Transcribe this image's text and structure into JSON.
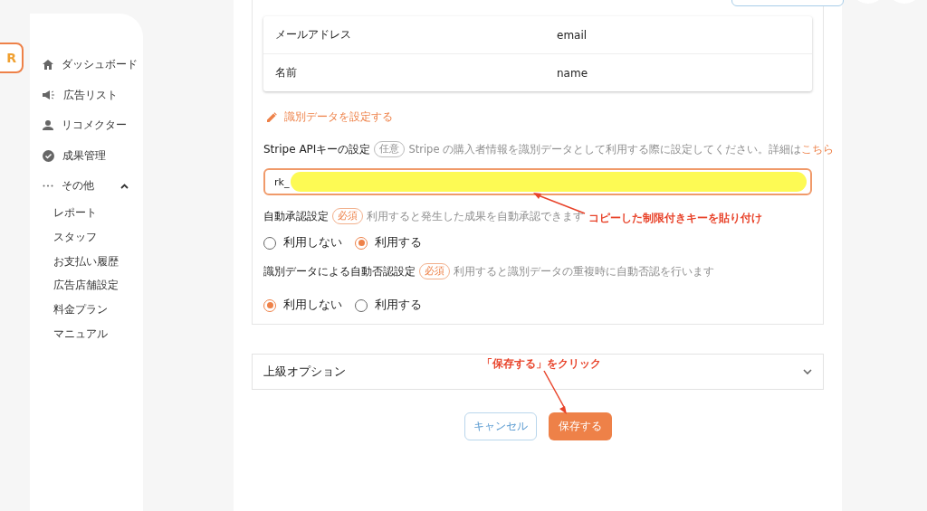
{
  "logo": {
    "text": "R"
  },
  "sidebar": {
    "items": [
      {
        "label": "ダッシュボード"
      },
      {
        "label": "広告リスト"
      },
      {
        "label": "リコメクター"
      },
      {
        "label": "成果管理"
      },
      {
        "label": "その他",
        "expanded": true,
        "children": [
          {
            "label": "レポート"
          },
          {
            "label": "スタッフ"
          },
          {
            "label": "お支払い履歴"
          },
          {
            "label": "広告店舗設定"
          },
          {
            "label": "料金プラン"
          },
          {
            "label": "マニュアル"
          }
        ]
      }
    ]
  },
  "mapping_table": {
    "rows": [
      {
        "label": "メールアドレス",
        "value": "email"
      },
      {
        "label": "名前",
        "value": "name"
      }
    ]
  },
  "edit_link": "識別データを設定する",
  "stripe": {
    "title": "Stripe APIキーの設定",
    "badge": "任意",
    "description": "Stripe の購入者情報を識別データとして利用する際に設定してください。詳細は",
    "link": "こちら",
    "value": "rk_"
  },
  "settings": [
    {
      "title": "自動承認設定",
      "badge": "必須",
      "description": "利用すると発生した成果を自動承認できます",
      "options": [
        {
          "label": "利用しない",
          "selected": false
        },
        {
          "label": "利用する",
          "selected": true
        }
      ]
    },
    {
      "title": "識別データによる自動否認設定",
      "badge": "必須",
      "description": "利用すると識別データの重複時に自動否認を行います",
      "options": [
        {
          "label": "利用しない",
          "selected": true
        },
        {
          "label": "利用する",
          "selected": false
        }
      ]
    }
  ],
  "advanced": {
    "title": "上級オプション",
    "expanded": false
  },
  "buttons": {
    "cancel": "キャンセル",
    "save": "保存する"
  },
  "annotations": [
    {
      "text": "コピーした制限付きキーを貼り付け"
    },
    {
      "text": "「保存する」をクリック"
    }
  ]
}
